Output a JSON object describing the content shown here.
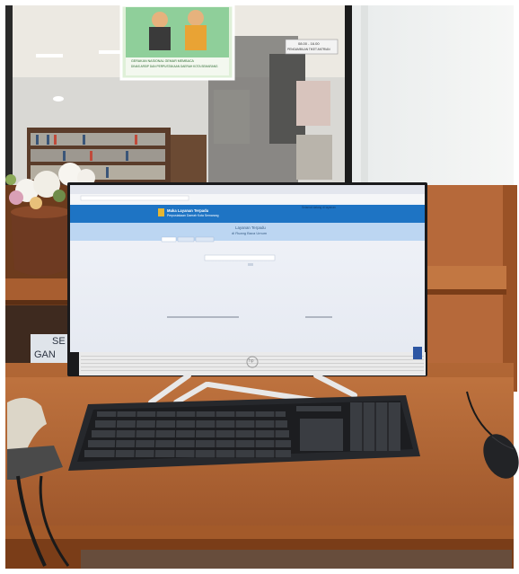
{
  "poster": {
    "caption_line1": "GERAKAN NASIONAL GEMAR MEMBACA",
    "caption_line2": "DINAS ARSIP DAN PERPUSTAKAAN DAERAH KOTA SEMARANG"
  },
  "wall_notice": {
    "line1": "08.00 - 16.00",
    "line2": "PENGAMBILAN TIKET ANTRIAN"
  },
  "counter_sign": {
    "line1": "SE",
    "line2": "GAN"
  },
  "monitor_page": {
    "app_title": "Muka Layanan Terpadu",
    "app_subtitle": "Perpustakaan Daerah Kota Semarang",
    "header_right": "Selamat datang di layanan",
    "center_heading_1": "Layanan Terpadu",
    "center_heading_2": "di Ruang Baca Umum",
    "brand": "hp"
  },
  "colors": {
    "wood": "#b86a35",
    "wood_dark": "#7a3d18",
    "screen_header": "#1e74c4",
    "screen_band": "#bcd6f2",
    "keyboard": "#26282c"
  }
}
